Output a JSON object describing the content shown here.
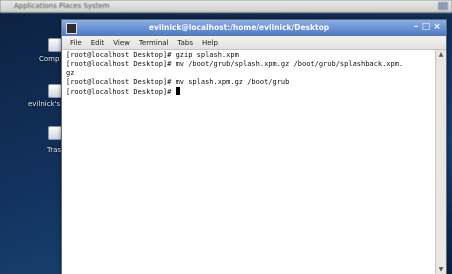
{
  "window": {
    "title": "evilnick@localhost:/home/evilnick/Desktop",
    "minimize_glyph": "–",
    "maximize_glyph": "□",
    "close_glyph": "×"
  },
  "menubar": {
    "file": "File",
    "edit": "Edit",
    "view": "View",
    "terminal": "Terminal",
    "tabs": "Tabs",
    "help": "Help"
  },
  "terminal": {
    "lines": [
      "[root@localhost Desktop]# gzip splash.xpm",
      "[root@localhost Desktop]# mv /boot/grub/splash.xpm.gz /boot/grub/splashback.xpm.",
      "gz",
      "[root@localhost Desktop]# mv splash.xpm.gz /boot/grub"
    ],
    "prompt": "[root@localhost Desktop]# "
  },
  "desktop": {
    "icons": [
      {
        "label": "Comp"
      },
      {
        "label": "evilnick's"
      },
      {
        "label": "Trash"
      }
    ]
  },
  "panel": {
    "left_text": "Applications   Places   System"
  },
  "colors": {
    "titlebar": "#4d77c3",
    "desktop_bg": "#12325e",
    "terminal_bg": "#ffffff"
  }
}
